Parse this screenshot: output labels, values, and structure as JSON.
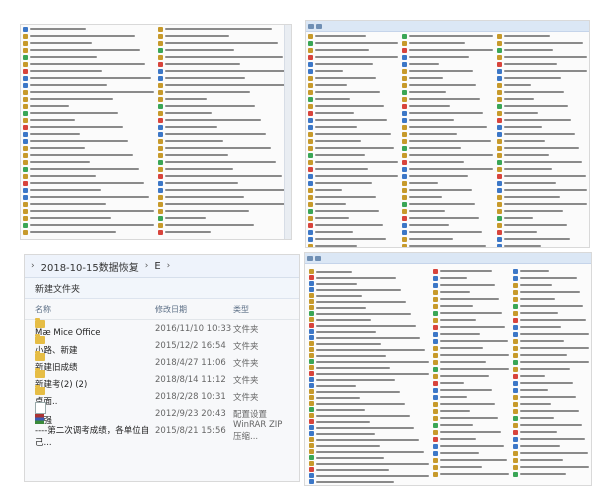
{
  "explorer": {
    "breadcrumb": [
      "2018-10-15数据恢复",
      "E"
    ],
    "toolbar_new_folder": "新建文件夹",
    "columns": {
      "name": "名称",
      "date": "修改日期",
      "type": "类型"
    },
    "rows": [
      {
        "name": "Mæ Mice Office",
        "date": "2016/11/10 10:33",
        "type": "文件夹",
        "icon": "folder"
      },
      {
        "name": "小路、新建",
        "date": "2015/12/2 16:54",
        "type": "文件夹",
        "icon": "folder"
      },
      {
        "name": "新建旧成绩",
        "date": "2018/4/27 11:06",
        "type": "文件夹",
        "icon": "folder"
      },
      {
        "name": "新建考(2) (2)",
        "date": "2018/8/14 11:12",
        "type": "文件夹",
        "icon": "folder"
      },
      {
        "name": "桌面..",
        "date": "2018/2/28 10:31",
        "type": "文件夹",
        "icon": "folder"
      },
      {
        "name": "ta强",
        "date": "2012/9/23 20:43",
        "type": "配置设置",
        "icon": "file"
      },
      {
        "name": "----第二次调考成绩，各单位自己...",
        "date": "2015/8/21 15:56",
        "type": "WinRAR ZIP 压缩...",
        "icon": "rar"
      }
    ]
  },
  "colors": {
    "folder": "#e6bd45",
    "address_bg": "#eef3fb",
    "header_blue": "#dbe7f5"
  },
  "icons": [
    "folder-icon",
    "file-icon",
    "rar-icon",
    "chevron-right-icon"
  ]
}
